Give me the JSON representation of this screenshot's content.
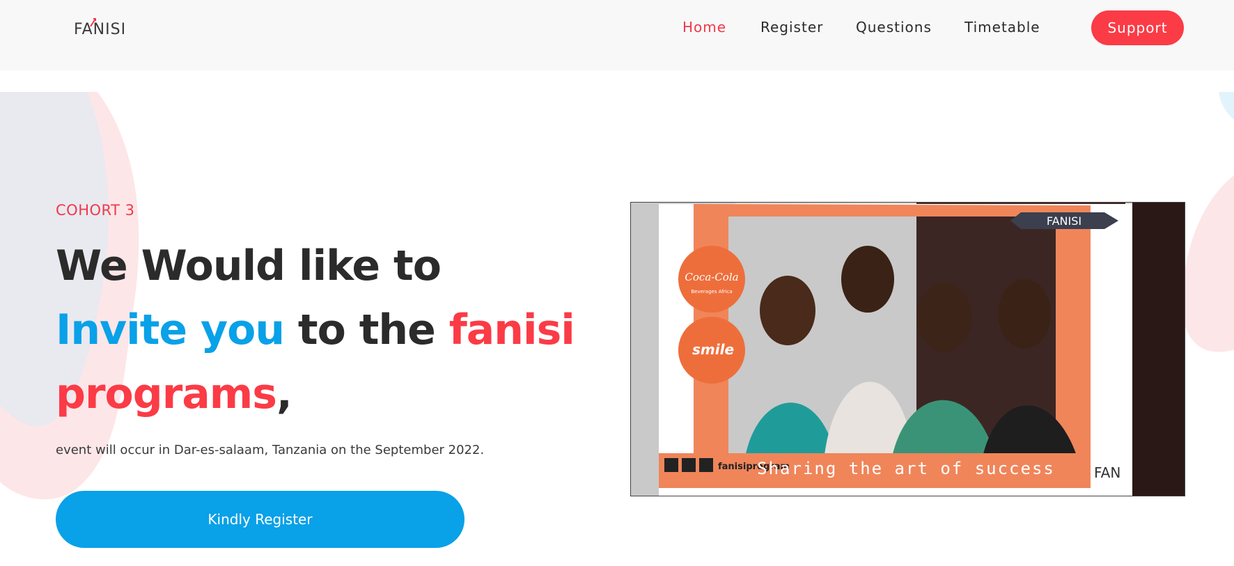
{
  "header": {
    "logo_text": "FANISI",
    "nav": [
      "Home",
      "Register",
      "Questions",
      "Timetable"
    ],
    "support_label": "Support",
    "active_nav": "Home"
  },
  "hero": {
    "eyebrow": "COHORT 3",
    "headline": {
      "part1": "We Would like to ",
      "part2": "Invite you",
      "part3": " to the ",
      "part4": "fanisi programs",
      "part5": ","
    },
    "subtitle": "event will occur in Dar-es-salaam, Tanzania on the September 2022.",
    "cta_label": "Kindly Register"
  },
  "photo": {
    "frame_brand": "FANISI",
    "sponsor1": "Coca-Cola",
    "sponsor1_sub": "Beverages Africa",
    "sponsor2": "smile",
    "social_handle": "fanisiprogram",
    "slogan": "Sharing the art of success",
    "corner_brand": "FAN"
  },
  "colors": {
    "accent_red": "#fb3b46",
    "accent_blue": "#09a1e8",
    "text_dark": "#2b2b2b"
  }
}
